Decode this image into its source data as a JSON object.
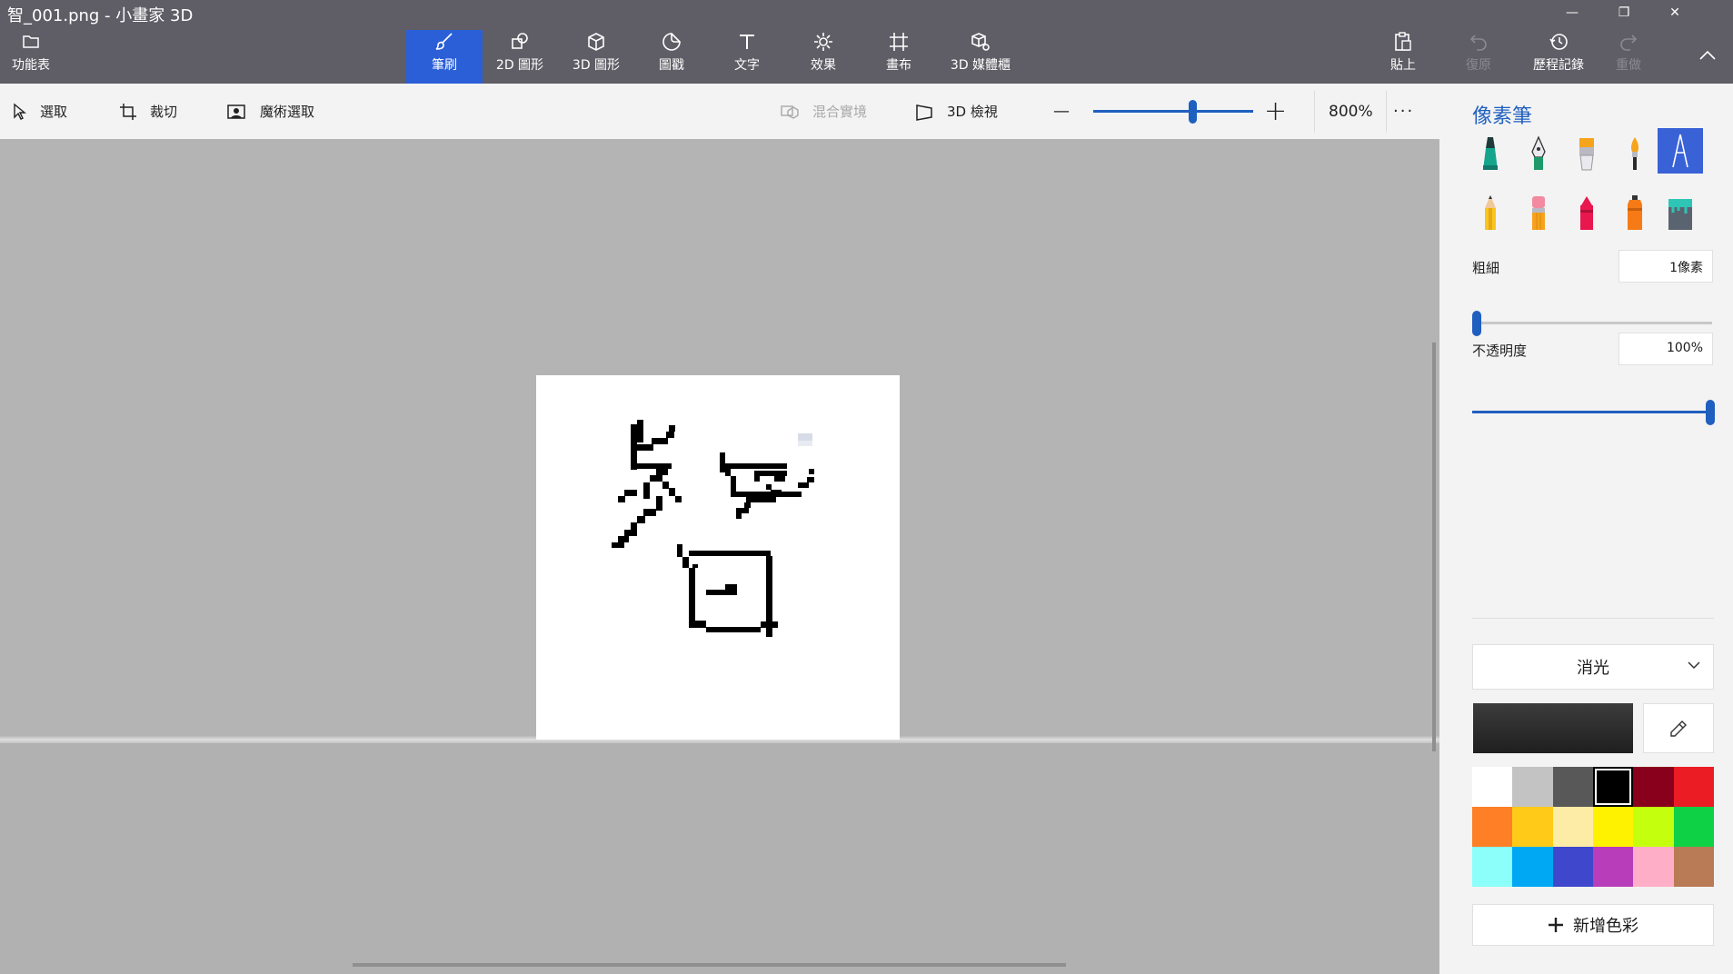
{
  "window": {
    "title": "智_001.png - 小畫家 3D",
    "minimize": "—",
    "restore": "❐",
    "close": "✕"
  },
  "ribbon": {
    "menu_label": "功能表",
    "tabs": [
      {
        "label": "筆刷",
        "icon": "brush-icon",
        "active": true
      },
      {
        "label": "2D 圖形",
        "icon": "2d-shapes-icon"
      },
      {
        "label": "3D 圖形",
        "icon": "3d-shapes-icon"
      },
      {
        "label": "圖戳",
        "icon": "sticker-icon"
      },
      {
        "label": "文字",
        "icon": "text-icon"
      },
      {
        "label": "效果",
        "icon": "effects-icon"
      },
      {
        "label": "畫布",
        "icon": "canvas-icon"
      },
      {
        "label": "3D 媒體櫃",
        "icon": "3d-library-icon"
      }
    ],
    "paste_label": "貼上",
    "undo_label": "復原",
    "history_label": "歷程記錄",
    "redo_label": "重做"
  },
  "toolbar": {
    "select_label": "選取",
    "crop_label": "裁切",
    "magic_select_label": "魔術選取",
    "mixed_reality_label": "混合實境",
    "view3d_label": "3D 檢視",
    "zoom_out": "—",
    "zoom_in": "+",
    "zoom_value": "800%",
    "more": "···"
  },
  "panel": {
    "title": "像素筆",
    "brushes": [
      {
        "name": "marker-icon",
        "selected": false
      },
      {
        "name": "calligraphy-pen-icon",
        "selected": false
      },
      {
        "name": "oil-brush-icon",
        "selected": false
      },
      {
        "name": "watercolor-icon",
        "selected": false
      },
      {
        "name": "pixel-pen-icon",
        "selected": true
      },
      {
        "name": "pencil-icon",
        "selected": false
      },
      {
        "name": "eraser-icon",
        "selected": false
      },
      {
        "name": "crayon-icon",
        "selected": false
      },
      {
        "name": "spray-can-icon",
        "selected": false
      },
      {
        "name": "fill-bucket-icon",
        "selected": false
      }
    ],
    "thickness_label": "粗細",
    "thickness_value": "1像素",
    "thickness_level": 0,
    "opacity_label": "不透明度",
    "opacity_value": "100%",
    "opacity_level": 1,
    "finish_label": "消光",
    "current_color": "#1f1f1f",
    "palette": [
      "#ffffff",
      "#c3c3c3",
      "#585858",
      "#000000",
      "#88001b",
      "#ec1c24",
      "#ff7f27",
      "#ffca18",
      "#fdeca6",
      "#fff200",
      "#c4ff0e",
      "#0ed145",
      "#8cfffb",
      "#00a8f3",
      "#3f48cc",
      "#b83dba",
      "#ffaec8",
      "#b97a56"
    ],
    "selected_swatch": 3,
    "add_color_label": "新增色彩"
  }
}
